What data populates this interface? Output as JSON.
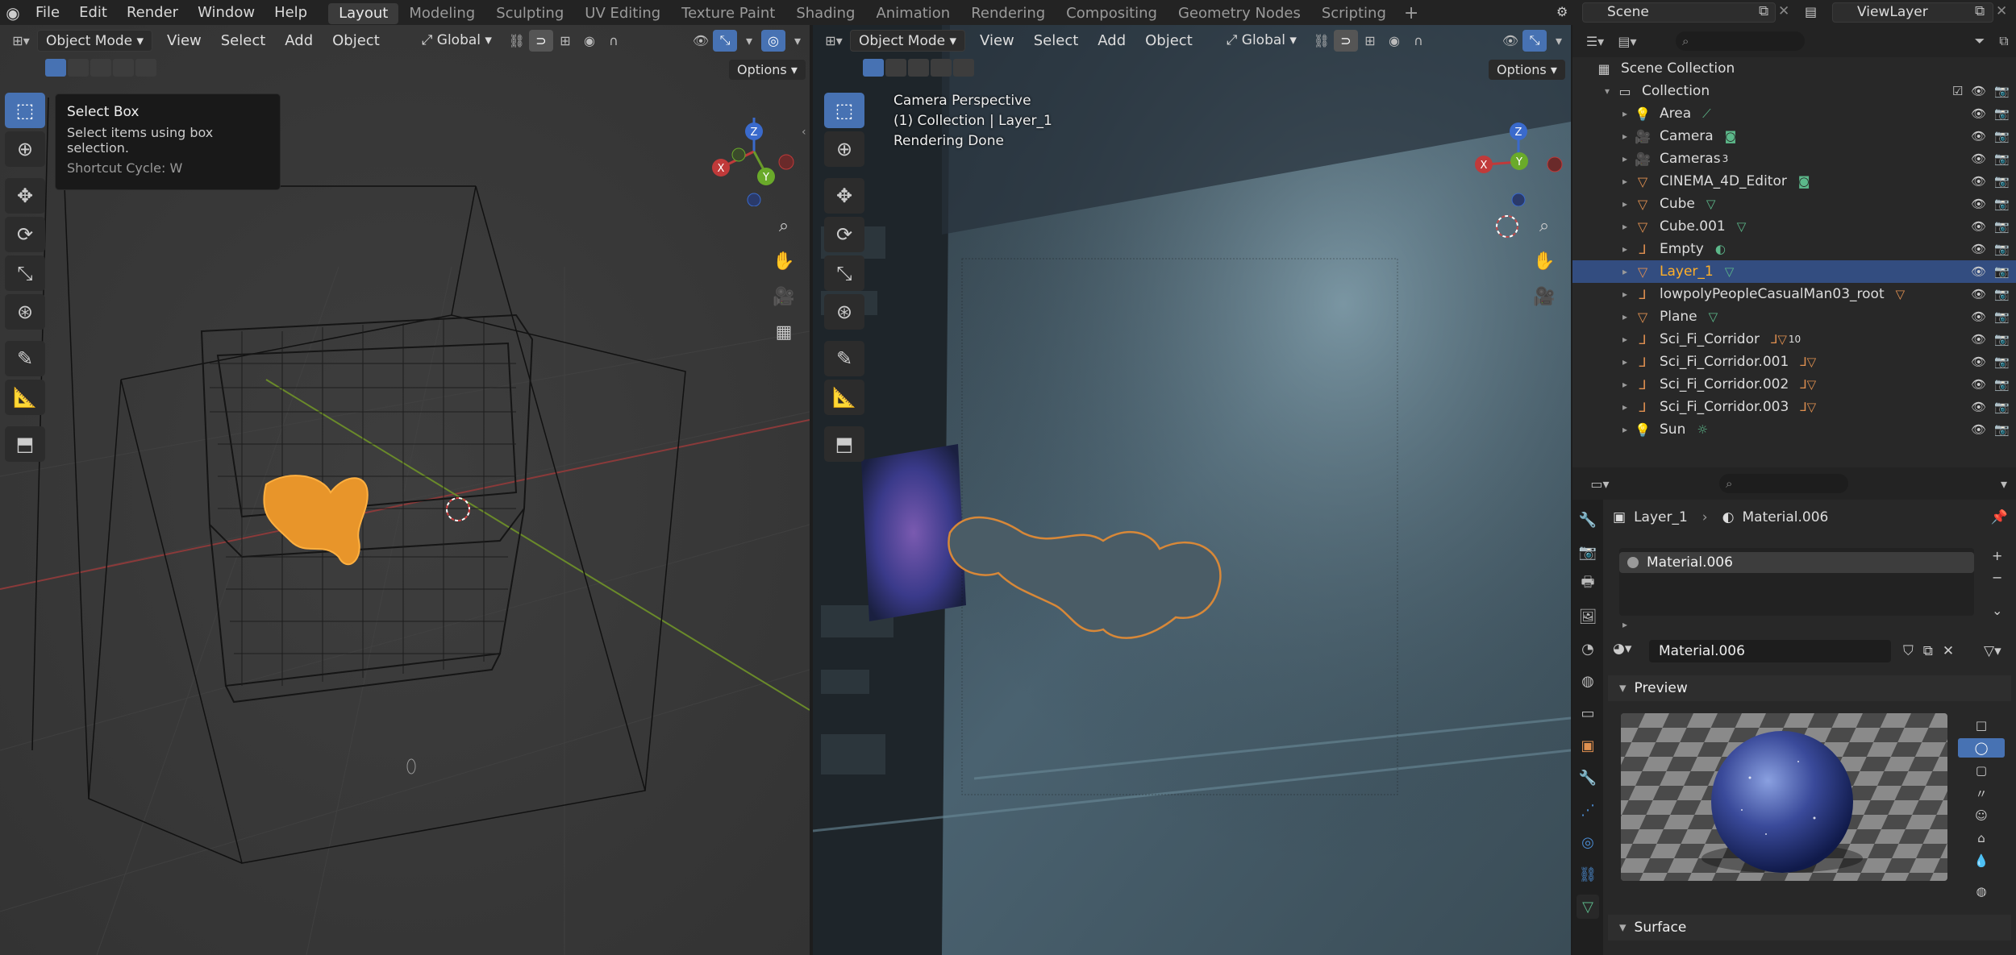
{
  "topbar": {
    "menus": [
      "File",
      "Edit",
      "Render",
      "Window",
      "Help"
    ],
    "workspaces": [
      "Layout",
      "Modeling",
      "Sculpting",
      "UV Editing",
      "Texture Paint",
      "Shading",
      "Animation",
      "Rendering",
      "Compositing",
      "Geometry Nodes",
      "Scripting"
    ],
    "active_workspace": "Layout",
    "add_workspace": "+",
    "scene": "Scene",
    "view_layer": "ViewLayer"
  },
  "left_viewport": {
    "mode": "Object Mode",
    "menus": [
      "View",
      "Select",
      "Add",
      "Object"
    ],
    "orientation": "Global",
    "options": "Options",
    "tooltip": {
      "title": "Select Box",
      "description": "Select items using box selection.",
      "shortcut": "Shortcut Cycle: W"
    }
  },
  "right_viewport": {
    "mode": "Object Mode",
    "menus": [
      "View",
      "Select",
      "Add",
      "Object"
    ],
    "orientation": "Global",
    "options": "Options",
    "overlay": {
      "line1": "Camera Perspective",
      "line2": "(1) Collection | Layer_1",
      "line3": "Rendering Done"
    }
  },
  "gizmo": {
    "x": "X",
    "y": "Y",
    "z": "Z"
  },
  "outliner": {
    "scene_collection": "Scene Collection",
    "collection": "Collection",
    "items": [
      {
        "name": "Area",
        "icon": "light-icon",
        "ext": "data-icon",
        "badge": ""
      },
      {
        "name": "Camera",
        "icon": "camera-icon",
        "ext": "camera-data-icon",
        "badge": ""
      },
      {
        "name": "Cameras",
        "icon": "camera-icon",
        "ext": "",
        "badge": "3"
      },
      {
        "name": "CINEMA_4D_Editor",
        "icon": "mesh-icon",
        "ext": "camera-data-icon",
        "badge": ""
      },
      {
        "name": "Cube",
        "icon": "mesh-icon",
        "ext": "mesh-data-icon",
        "badge": ""
      },
      {
        "name": "Cube.001",
        "icon": "mesh-icon",
        "ext": "mesh-data-icon",
        "badge": ""
      },
      {
        "name": "Empty",
        "icon": "empty-icon",
        "ext": "constraint-icon",
        "badge": ""
      },
      {
        "name": "Layer_1",
        "icon": "mesh-icon",
        "ext": "mesh-data-icon",
        "badge": ""
      },
      {
        "name": "lowpolyPeopleCasualMan03_root",
        "icon": "empty-icon",
        "ext": "mesh-icon",
        "badge": ""
      },
      {
        "name": "Plane",
        "icon": "mesh-icon",
        "ext": "mesh-data-icon",
        "badge": ""
      },
      {
        "name": "Sci_Fi_Corridor",
        "icon": "empty-icon",
        "ext": "child-icon",
        "badge": "10"
      },
      {
        "name": "Sci_Fi_Corridor.001",
        "icon": "empty-icon",
        "ext": "child-icon",
        "badge": ""
      },
      {
        "name": "Sci_Fi_Corridor.002",
        "icon": "empty-icon",
        "ext": "child-icon",
        "badge": ""
      },
      {
        "name": "Sci_Fi_Corridor.003",
        "icon": "empty-icon",
        "ext": "child-icon",
        "badge": ""
      },
      {
        "name": "Sun",
        "icon": "light-icon",
        "ext": "sun-data-icon",
        "badge": ""
      }
    ],
    "selected": "Layer_1"
  },
  "properties": {
    "breadcrumb_object": "Layer_1",
    "breadcrumb_material": "Material.006",
    "slot": "Material.006",
    "material_name": "Material.006",
    "panel_preview": "Preview",
    "panel_surface": "Surface"
  },
  "colors": {
    "accent": "#4772b3",
    "selection": "#ffaf29",
    "header": "#232323",
    "panel": "#282828"
  }
}
